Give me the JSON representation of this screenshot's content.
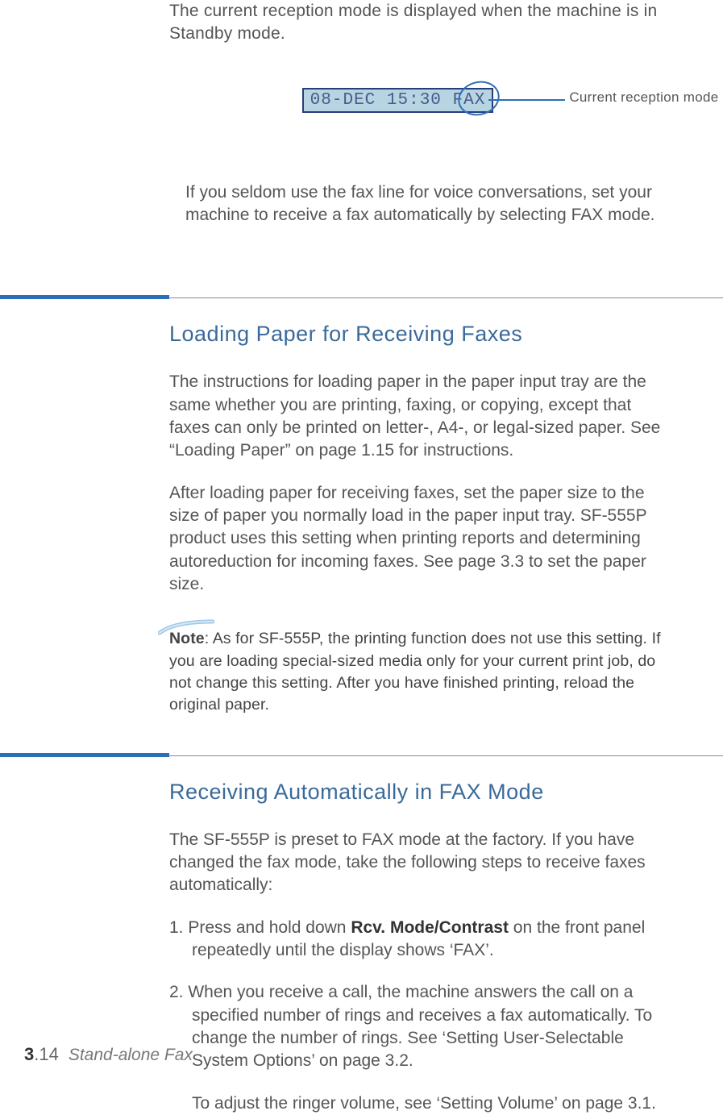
{
  "intro": "The current reception mode is displayed when the machine is in Standby mode.",
  "lcd_text": "08-DEC 15:30 FAX",
  "callout": "Current reception mode",
  "indent_para": "If you seldom use the fax line for voice conversations, set your machine to receive a fax automatically by selecting FAX mode.",
  "section1": {
    "heading": "Loading Paper for Receiving Faxes",
    "para1": "The instructions for loading paper in the paper input tray are the same whether you are printing, faxing, or copying, except that faxes can only be printed on letter-, A4-, or legal-sized paper. See “Loading Paper” on page 1.15 for instructions.",
    "para2": "After loading paper for receiving faxes, set the paper size to the size of paper you normally load in the paper input tray. SF-555P product uses this setting when printing reports and determining autoreduction for incoming faxes. See page 3.3 to set the paper size.",
    "note_label": "Note",
    "note_body": ": As for SF-555P, the printing function does not use this setting. If you are loading special-sized media only for your current print job, do not change this setting. After you have finished printing, reload the original paper."
  },
  "section2": {
    "heading": "Receiving Automatically in FAX Mode",
    "para1": "The SF-555P is preset to FAX mode at the factory. If you have changed the fax mode, take the following steps to receive faxes automatically:",
    "step1_pre": "1. Press and hold down ",
    "step1_bold": "Rcv. Mode/Contrast",
    "step1_post": " on the front panel repeatedly until the display shows ‘FAX’.",
    "step2": "2. When you receive a call, the machine answers the call on a specified number of rings and receives a fax automatically. To change the number of rings. See ‘Setting User-Selectable System Options’ on page 3.2.",
    "final": "To adjust the ringer volume, see ‘Setting Volume’ on page 3.1."
  },
  "footer": {
    "chapter": "3",
    "page": ".14",
    "label": "Stand-alone Fax"
  }
}
